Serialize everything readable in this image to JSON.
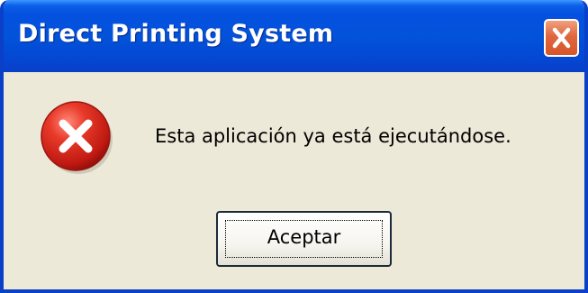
{
  "dialog": {
    "title": "Direct Printing System",
    "message": "Esta aplicación ya está ejecutándose.",
    "ok_label": "Aceptar",
    "icon": "error-icon",
    "close_icon": "close-icon"
  },
  "colors": {
    "titlebar": "#0353da",
    "window_border": "#0a3fc8",
    "dialog_background": "#ece9d8",
    "close_button": "#e0663f",
    "error_icon": "#d42020"
  }
}
